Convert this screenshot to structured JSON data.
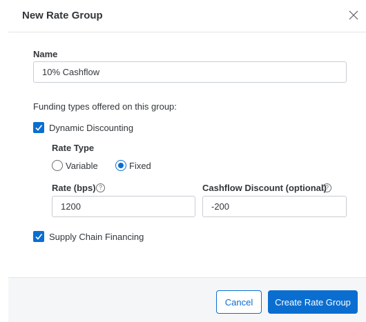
{
  "dialog": {
    "title": "New Rate Group",
    "close_icon": "close-icon"
  },
  "name": {
    "label": "Name",
    "value": "10% Cashflow"
  },
  "funding": {
    "intro": "Funding types offered on this group:",
    "dynamic_discounting": {
      "label": "Dynamic Discounting",
      "checked": true
    },
    "rate_type": {
      "label": "Rate Type",
      "options": [
        {
          "label": "Variable",
          "selected": false
        },
        {
          "label": "Fixed",
          "selected": true
        }
      ]
    },
    "rate": {
      "label": "Rate (bps)",
      "value": "1200",
      "help_icon": "?"
    },
    "cashflow_discount": {
      "label": "Cashflow Discount (optional)",
      "value": "-200",
      "help_icon": "?"
    },
    "supply_chain": {
      "label": "Supply Chain Financing",
      "checked": true
    }
  },
  "footer": {
    "cancel_label": "Cancel",
    "create_label": "Create Rate Group"
  },
  "colors": {
    "accent": "#0a6ed1",
    "text": "#32363a",
    "footer_bg": "#f5f6f7"
  }
}
